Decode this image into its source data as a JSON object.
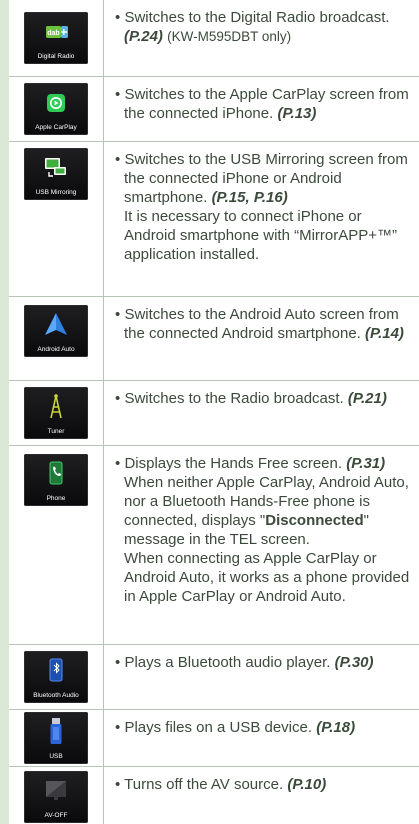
{
  "rows": [
    {
      "tile_label": "Digital Radio",
      "bullet": "•",
      "text": "Switches to the Digital Radio broadcast.",
      "ref": "(P.24)",
      "after": "(KW-M595DBT only)"
    },
    {
      "tile_label": "Apple CarPlay",
      "bullet": "•",
      "text": "Switches to the Apple CarPlay screen from the connected iPhone.",
      "ref": "(P.13)"
    },
    {
      "tile_label": "USB Mirroring",
      "bullet": "•",
      "text": "Switches to the USB Mirroring screen from the connected iPhone or Android smartphone.",
      "ref": "(P.15, P.16)",
      "note": "It is necessary to connect iPhone or Android smartphone with “MirrorAPP+™” application installed."
    },
    {
      "tile_label": "Android Auto",
      "bullet": "•",
      "text": "Switches to the Android Auto screen from the connected Android smartphone.",
      "ref": "(P.14)"
    },
    {
      "tile_label": "Tuner",
      "bullet": "•",
      "text": "Switches to the Radio broadcast.",
      "ref": "(P.21)"
    },
    {
      "tile_label": "Phone",
      "bullet": "•",
      "text": "Displays the Hands Free screen.",
      "ref": "(P.31)",
      "note1_a": "When neither Apple CarPlay, Android Auto, nor a Bluetooth Hands-Free phone is connected, displays \"",
      "note1_b": "Disconnected",
      "note1_c": "\" message in the TEL screen.",
      "note2": "When connecting as Apple CarPlay or Android Auto, it works as a phone provided in Apple CarPlay or Android Auto."
    },
    {
      "tile_label": "Bluetooth Audio",
      "bullet": "•",
      "text": "Plays a Bluetooth audio player.",
      "ref": "(P.30)"
    },
    {
      "tile_label": "USB",
      "bullet": "•",
      "text": "Plays files on a USB device.",
      "ref": "(P.18)"
    },
    {
      "tile_label": "AV-OFF",
      "bullet": "•",
      "text": "Turns off the AV source.",
      "ref": "(P.10)"
    }
  ],
  "icons": [
    "dab-icon",
    "carplay-icon",
    "usb-mirroring-icon",
    "android-auto-icon",
    "tuner-icon",
    "phone-icon",
    "bluetooth-audio-icon",
    "usb-icon",
    "av-off-icon"
  ],
  "colors": {
    "background": "#dce8d6",
    "text": "#3b4a3b",
    "rule": "#b9c4b9",
    "tile": "#111114"
  }
}
